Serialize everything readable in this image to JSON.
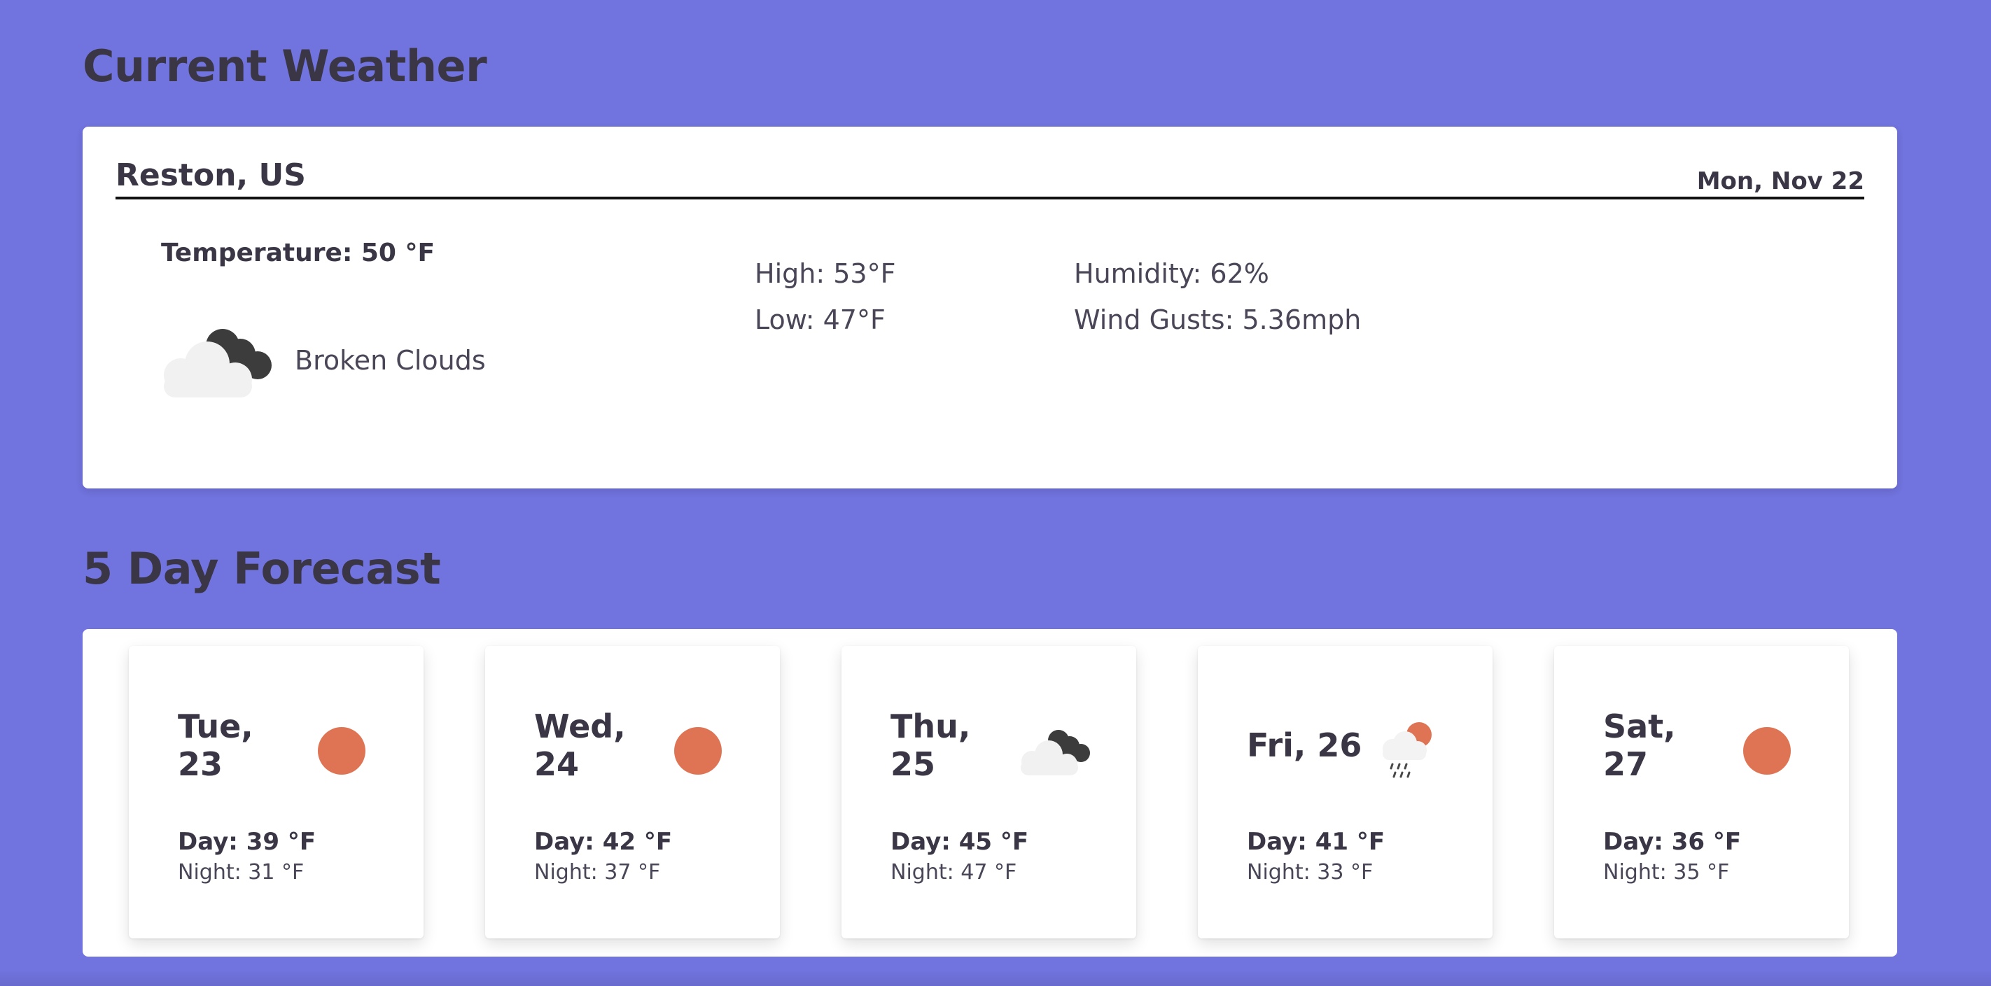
{
  "current_section": {
    "title": "Current Weather",
    "city": "Reston, US",
    "date": "Mon, Nov 22",
    "temperature": "Temperature: 50 °F",
    "condition": "Broken Clouds",
    "condition_icon": "broken-clouds-icon",
    "high": "High: 53°F",
    "low": "Low: 47°F",
    "humidity": "Humidity: 62%",
    "wind": "Wind Gusts: 5.36mph"
  },
  "forecast_section": {
    "title": "5 Day Forecast",
    "days": [
      {
        "name": "Tue,\n23",
        "icon": "sun-icon",
        "day": "Day: 39 °F",
        "night": "Night: 31 °F"
      },
      {
        "name": "Wed,\n24",
        "icon": "sun-icon",
        "day": "Day: 42 °F",
        "night": "Night: 37 °F"
      },
      {
        "name": "Thu,\n25",
        "icon": "broken-clouds-icon",
        "day": "Day: 45 °F",
        "night": "Night: 47 °F"
      },
      {
        "name": "Fri, 26",
        "icon": "rain-sun-icon",
        "day": "Day: 41 °F",
        "night": "Night: 33 °F"
      },
      {
        "name": "Sat,\n27",
        "icon": "sun-icon",
        "day": "Day: 36 °F",
        "night": "Night: 35 °F"
      }
    ]
  },
  "colors": {
    "background": "#7173de",
    "text": "#3a3645",
    "sun": "#df7455",
    "cloud_light": "#f1f1f1",
    "cloud_dark": "#3c3c3c"
  }
}
